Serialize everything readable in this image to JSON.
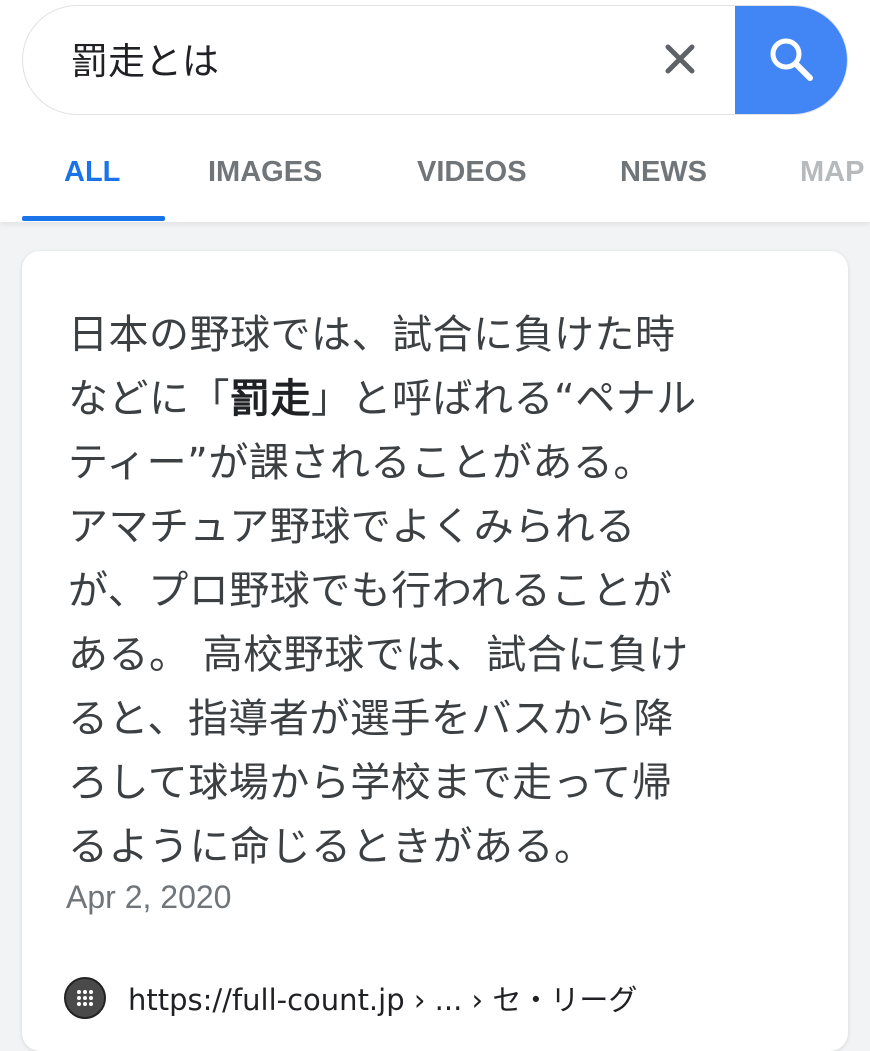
{
  "search": {
    "query": "罰走とは",
    "clear_icon": "close-icon",
    "submit_icon": "search-icon"
  },
  "tabs": [
    {
      "label": "ALL",
      "active": true
    },
    {
      "label": "IMAGES",
      "active": false
    },
    {
      "label": "VIDEOS",
      "active": false
    },
    {
      "label": "NEWS",
      "active": false
    },
    {
      "label": "MAP",
      "active": false
    }
  ],
  "result": {
    "snippet_lines": [
      "日本の野球では、試合に負けた時",
      "などに「",
      "罰走",
      "」と呼ばれる“ペナル",
      "ティー”が課されることがある。",
      "アマチュア野球でよくみられる",
      "が、プロ野球でも行われることが",
      "ある。 高校野球では、試合に負け",
      "ると、指導者が選手をバスから降",
      "ろして球場から学校まで走って帰",
      "るように命じるときがある。"
    ],
    "date": "Apr 2, 2020",
    "source_url": "https://full-count.jp › ... › セ・リーグ",
    "favicon_icon": "site-favicon-icon"
  },
  "colors": {
    "accent": "#1a73e8",
    "search_button": "#4285f4",
    "tab_inactive": "#70757a",
    "text": "#3c4043"
  }
}
